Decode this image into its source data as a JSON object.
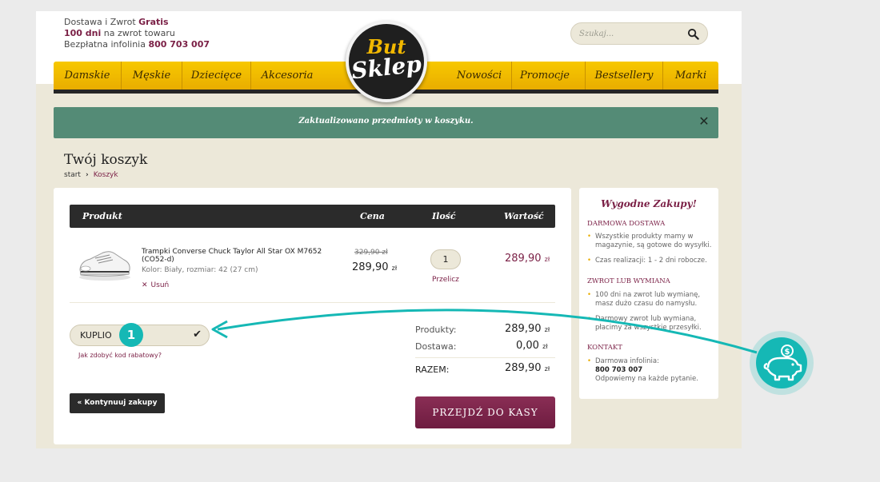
{
  "top_info": {
    "line1_prefix": "Dostawa i Zwrot ",
    "line1_bold": "Gratis",
    "line2_bold": "100 dni",
    "line2_suffix": " na zwrot towaru",
    "line3_prefix": "Bezpłatna infolinia ",
    "line3_bold": "800 703 007"
  },
  "search": {
    "placeholder": "Szukaj..."
  },
  "logo": {
    "line1": "But",
    "line2": "Sklep"
  },
  "nav": {
    "left": [
      "Damskie",
      "Męskie",
      "Dziecięce",
      "Akcesoria"
    ],
    "right": [
      "Nowości",
      "Promocje",
      "Bestsellery",
      "Marki"
    ]
  },
  "alert": {
    "text": "Zaktualizowano przedmioty w koszyku.",
    "close": "✕"
  },
  "page": {
    "title": "Twój koszyk",
    "breadcrumb_home": "start",
    "breadcrumb_sep": "›",
    "breadcrumb_current": "Koszyk"
  },
  "table": {
    "col_product": "Produkt",
    "col_price": "Cena",
    "col_qty": "Ilość",
    "col_value": "Wartość"
  },
  "item": {
    "name": "Trampki Converse Chuck Taylor All Star OX M7652 (CO52-d)",
    "attributes": "Kolor: Biały, rozmiar: 42 (27 cm)",
    "remove_label": "Usuń",
    "old_price": "329,90 zł",
    "price": "289,90",
    "currency": "zł",
    "quantity": "1",
    "recalc_label": "Przelicz",
    "value": "289,90"
  },
  "coupon": {
    "value": "KUPLIO",
    "link": "Jak zdobyć kod rabatowy?",
    "badge": "1"
  },
  "summary": {
    "products_label": "Produkty:",
    "products_value": "289,90",
    "shipping_label": "Dostawa:",
    "shipping_value": "0,00",
    "total_label": "RAZEM:",
    "total_value": "289,90",
    "currency": "zł"
  },
  "buttons": {
    "continue": "« Kontynuuj zakupy",
    "checkout": "PRZEJDŹ DO KASY"
  },
  "sidebar": {
    "title": "Wygodne Zakupy!",
    "h1": "Darmowa dostawa",
    "b1": "Wszystkie produkty mamy w magazynie, są gotowe do wysyłki.",
    "b2": "Czas realizacji: 1 - 2 dni robocze.",
    "h2": "Zwrot lub wymiana",
    "b3": "100 dni na zwrot lub wymianę, masz dużo czasu do namysłu.",
    "b4": "Darmowy zwrot lub wymiana, płacimy za wszystkie przesyłki.",
    "h3": "Kontakt",
    "b5_label": "Darmowa infolinia:",
    "b5_phone": "800 703 007",
    "b5_note": "Odpowiemy na każde pytanie."
  },
  "colors": {
    "brand": "#7a1f45",
    "accent": "#f2b800",
    "teal": "#15b8b5",
    "alert": "#548b76"
  }
}
